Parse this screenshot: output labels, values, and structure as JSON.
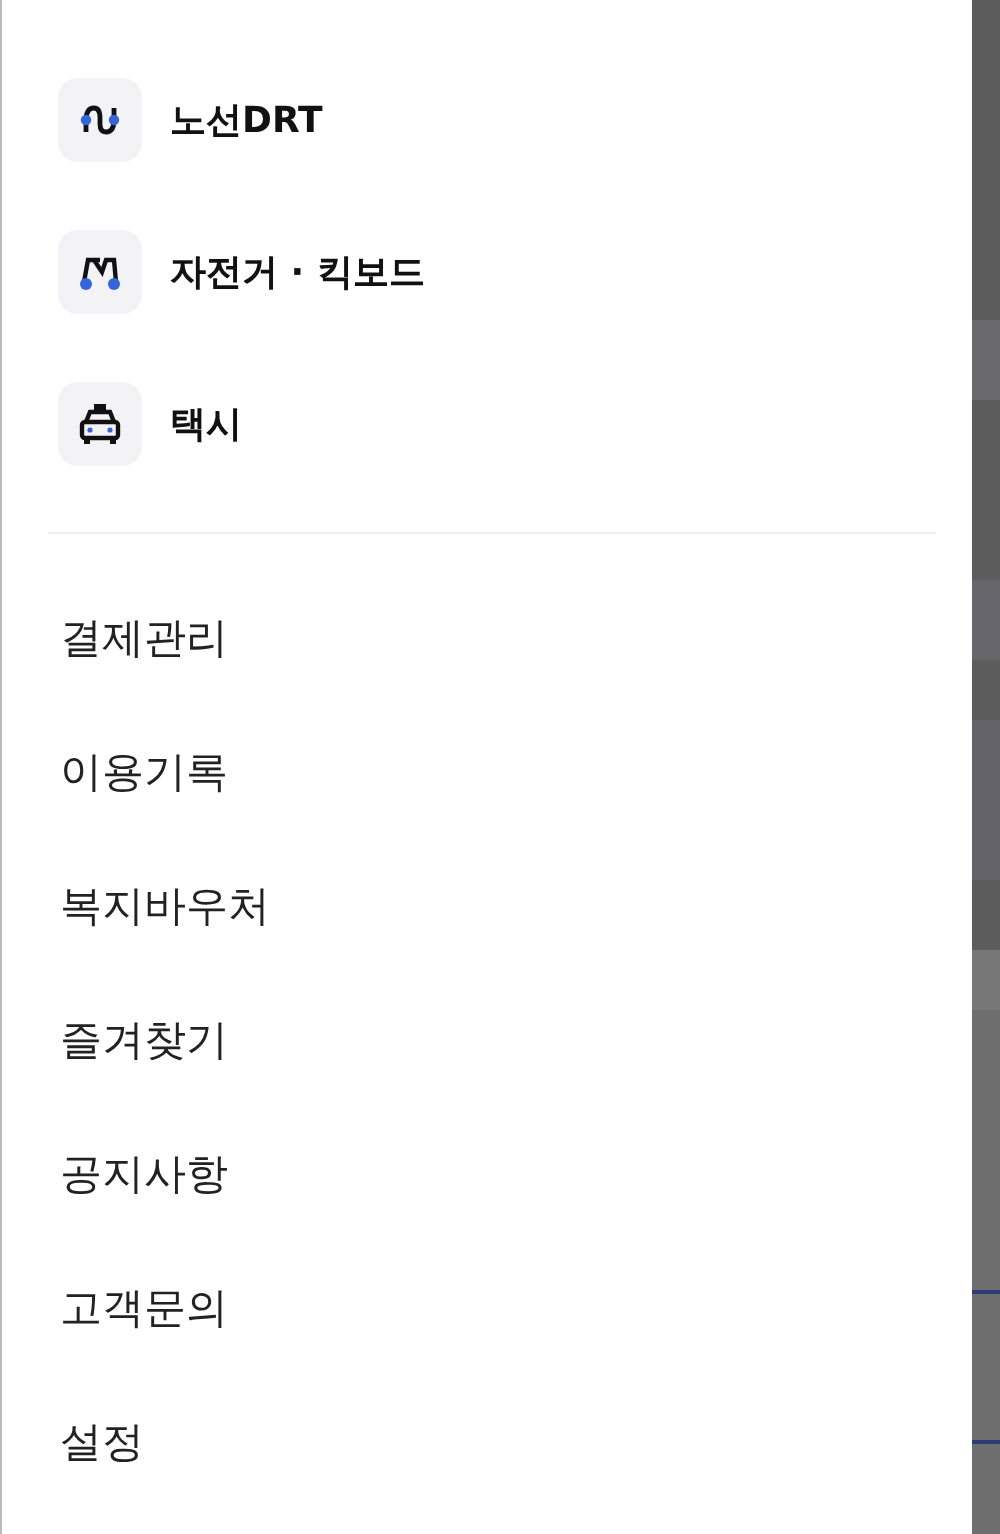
{
  "services": [
    {
      "kind": "route",
      "label": "노선DRT"
    },
    {
      "kind": "bike",
      "label": "자전거 · 킥보드"
    },
    {
      "kind": "taxi",
      "label": "택시"
    }
  ],
  "menu": [
    "결제관리",
    "이용기록",
    "복지바우처",
    "즐겨찾기",
    "공지사항",
    "고객문의",
    "설정"
  ]
}
